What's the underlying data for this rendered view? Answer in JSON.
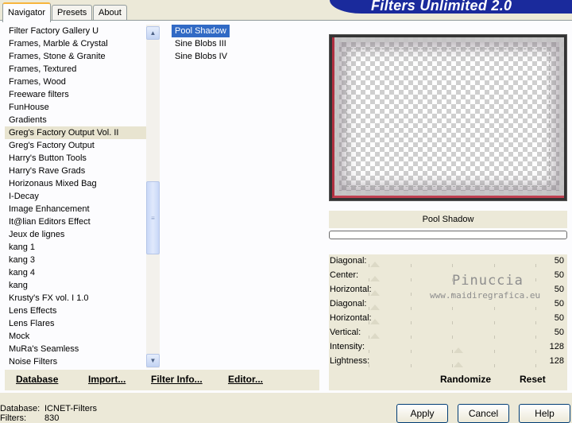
{
  "tabs": [
    {
      "label": "Navigator",
      "active": true
    },
    {
      "label": "Presets",
      "active": false
    },
    {
      "label": "About",
      "active": false
    }
  ],
  "banner_title": "Filters Unlimited 2.0",
  "categories": [
    "Filter Factory Gallery U",
    "Frames, Marble & Crystal",
    "Frames, Stone & Granite",
    "Frames, Textured",
    "Frames, Wood",
    "Freeware filters",
    "FunHouse",
    "Gradients",
    "Greg's Factory Output Vol. II",
    "Greg's Factory Output",
    "Harry's Button Tools",
    "Harry's Rave Grads",
    "Horizonaus Mixed Bag",
    "I-Decay",
    "Image Enhancement",
    "It@lian Editors Effect",
    "Jeux de lignes",
    "kang 1",
    "kang 3",
    "kang 4",
    "kang",
    "Krusty's FX vol. I 1.0",
    "Lens Effects",
    "Lens Flares",
    "Mock",
    "MuRa's Seamless",
    "Noise Filters"
  ],
  "selected_category": "Greg's Factory Output Vol. II",
  "filters": [
    "Pool Shadow",
    "Sine Blobs III",
    "Sine Blobs IV"
  ],
  "selected_filter": "Pool Shadow",
  "filter_title": "Pool Shadow",
  "sliders": [
    {
      "label": "Diagonal:",
      "value": "50",
      "fraction": 0.0
    },
    {
      "label": "Center:",
      "value": "50",
      "fraction": 0.0
    },
    {
      "label": "Horizontal:",
      "value": "50",
      "fraction": 0.0
    },
    {
      "label": "Diagonal:",
      "value": "50",
      "fraction": 0.0
    },
    {
      "label": "Horizontal:",
      "value": "50",
      "fraction": 0.0
    },
    {
      "label": "Vertical:",
      "value": "50",
      "fraction": 0.0
    },
    {
      "label": "Intensity:",
      "value": "128",
      "fraction": 0.5
    },
    {
      "label": "Lightness:",
      "value": "128",
      "fraction": 0.5
    }
  ],
  "watermark": {
    "name": "Pinuccia",
    "url": "www.maidiregrafica.eu"
  },
  "toolbar": {
    "database": "Database",
    "import": "Import...",
    "filter_info": "Filter Info...",
    "editor": "Editor...",
    "randomize": "Randomize",
    "reset": "Reset"
  },
  "footer": {
    "database_label": "Database:",
    "database_value": "ICNET-Filters",
    "filters_label": "Filters:",
    "filters_value": "830",
    "apply": "Apply",
    "cancel": "Cancel",
    "help": "Help"
  },
  "colors": {
    "accent": "#316ac5",
    "banner": "#1a2a9c",
    "tab_highlight": "#f7b53d"
  }
}
